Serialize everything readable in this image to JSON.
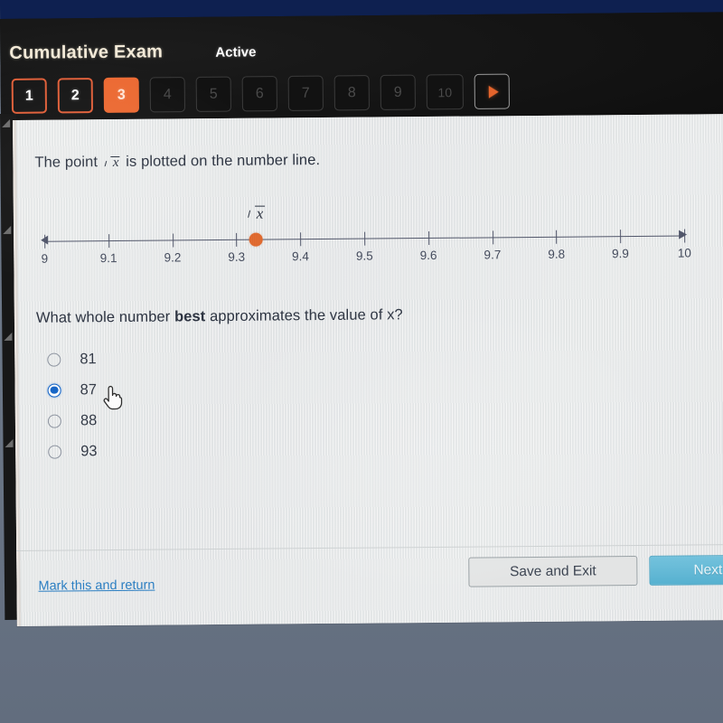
{
  "header": {
    "title": "Cumulative Exam",
    "status": "Active",
    "tabs": [
      {
        "label": "1",
        "state": "done"
      },
      {
        "label": "2",
        "state": "done"
      },
      {
        "label": "3",
        "state": "active"
      },
      {
        "label": "4",
        "state": "locked"
      },
      {
        "label": "5",
        "state": "locked"
      },
      {
        "label": "6",
        "state": "locked"
      },
      {
        "label": "7",
        "state": "locked"
      },
      {
        "label": "8",
        "state": "locked"
      },
      {
        "label": "9",
        "state": "locked"
      },
      {
        "label": "10",
        "state": "locked"
      }
    ],
    "next_arrow_icon": "play-triangle-icon"
  },
  "question": {
    "stem_before": "The point",
    "stem_radicand": "x",
    "stem_after": "is plotted on the number line.",
    "prompt_before": "What whole number ",
    "prompt_bold": "best",
    "prompt_after": " approximates the value of x?"
  },
  "number_line": {
    "point_label_radicand": "x",
    "point_value": 9.33,
    "min": 9,
    "max": 10,
    "tick_step": 0.1,
    "tick_labels": [
      "9",
      "9.1",
      "9.2",
      "9.3",
      "9.4",
      "9.5",
      "9.6",
      "9.7",
      "9.8",
      "9.9",
      "10"
    ],
    "dot_color": "#e1692e",
    "axis_color": "#51566a"
  },
  "options": [
    {
      "label": "81",
      "selected": false
    },
    {
      "label": "87",
      "selected": true
    },
    {
      "label": "88",
      "selected": false
    },
    {
      "label": "93",
      "selected": false
    }
  ],
  "cursor": {
    "icon": "pointing-hand-cursor",
    "over_option": "87"
  },
  "footer": {
    "mark_link": "Mark this and return",
    "save_button": "Save and Exit",
    "next_button": "Next"
  },
  "colors": {
    "accent_orange": "#ec6a33",
    "selected_blue": "#1565c8",
    "next_blue": "#55b2d2",
    "link_blue": "#2b7fc4",
    "header_dark": "#141414",
    "top_strip_navy": "#0e2050"
  },
  "chart_data": {
    "type": "line",
    "title": "",
    "xlabel": "",
    "ylabel": "",
    "xlim": [
      9,
      10
    ],
    "grid": false,
    "categories": [
      "9",
      "9.1",
      "9.2",
      "9.3",
      "9.4",
      "9.5",
      "9.6",
      "9.7",
      "9.8",
      "9.9",
      "10"
    ],
    "values": [
      9,
      9.1,
      9.2,
      9.3,
      9.4,
      9.5,
      9.6,
      9.7,
      9.8,
      9.9,
      10
    ],
    "annotations": [
      {
        "label": "sqrt(x)",
        "x": 9.33
      }
    ]
  }
}
